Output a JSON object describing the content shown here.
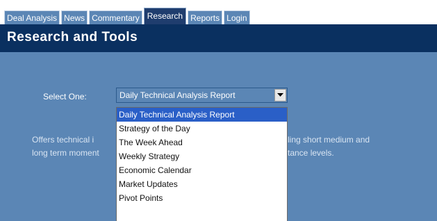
{
  "tabs": [
    {
      "label": "Deal Analysis"
    },
    {
      "label": "News"
    },
    {
      "label": "Commentary"
    },
    {
      "label": "Research",
      "active": true
    },
    {
      "label": "Reports"
    },
    {
      "label": "Login"
    }
  ],
  "header": {
    "title": "Research and Tools"
  },
  "select": {
    "label": "Select One:",
    "value": "Daily Technical Analysis Report"
  },
  "description": {
    "line1_left": "Offers technical i",
    "line1_right": "ling short medium and",
    "line2_left": "long term moment",
    "line2_right": "tance levels."
  },
  "dropdown": {
    "options": [
      {
        "label": "Daily Technical Analysis Report",
        "selected": true
      },
      {
        "label": "Strategy of the Day"
      },
      {
        "label": "The Week Ahead"
      },
      {
        "label": "Weekly Strategy"
      },
      {
        "label": "Economic Calendar"
      },
      {
        "label": "Market Updates"
      },
      {
        "label": "Pivot Points"
      }
    ]
  },
  "colors": {
    "tab_bg": "#5b86b5",
    "tab_active_bg": "#1f3d6e",
    "header_bg": "#0a3060",
    "panel_bg": "#5b86b5",
    "selection": "#2a5fc7"
  }
}
